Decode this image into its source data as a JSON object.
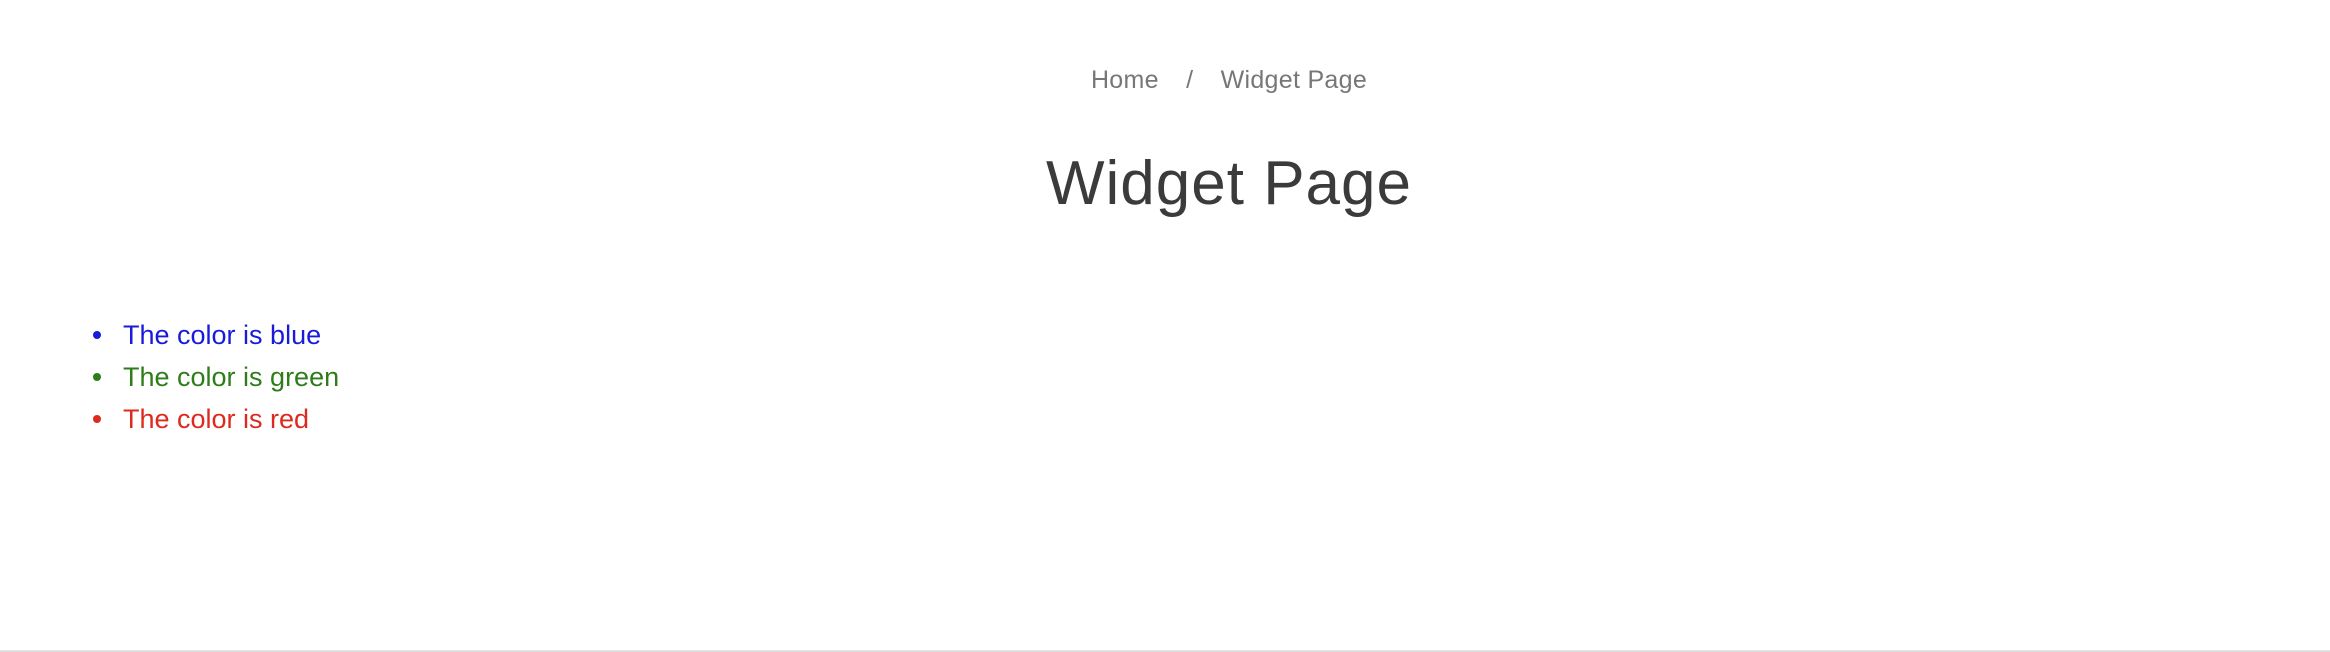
{
  "breadcrumb": {
    "home_label": "Home",
    "separator": "/",
    "current_label": "Widget Page"
  },
  "page": {
    "title": "Widget Page"
  },
  "color_list": {
    "items": [
      {
        "label": "The color is blue",
        "color": "#1a1adb"
      },
      {
        "label": "The color is green",
        "color": "#2e7d1a"
      },
      {
        "label": "The color is red",
        "color": "#dd2a1e"
      }
    ]
  }
}
